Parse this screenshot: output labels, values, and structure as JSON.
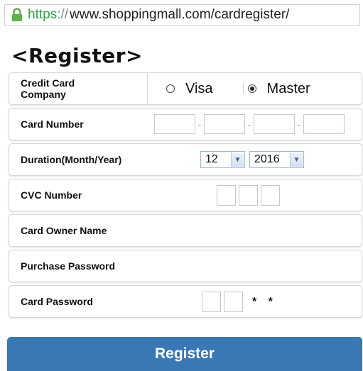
{
  "address_bar": {
    "scheme": "https",
    "separator": "://",
    "host": "www.shoppingmall.com/cardregister/",
    "icon": "lock-icon"
  },
  "page": {
    "title": "<Register>"
  },
  "form": {
    "company": {
      "label": "Credit Card Company",
      "options": [
        {
          "label": "Visa",
          "checked": false
        },
        {
          "label": "Master",
          "checked": true
        }
      ]
    },
    "card_number": {
      "label": "Card Number",
      "separator": "-"
    },
    "duration": {
      "label": "Duration(Month/Year)",
      "month": "12",
      "year": "2016"
    },
    "cvc": {
      "label": "CVC Number"
    },
    "owner": {
      "label": "Card Owner Name"
    },
    "purchase_password": {
      "label": "Purchase Password"
    },
    "card_password": {
      "label": "Card Password",
      "masked": "* *"
    }
  },
  "register_button": {
    "label": "Register"
  }
}
